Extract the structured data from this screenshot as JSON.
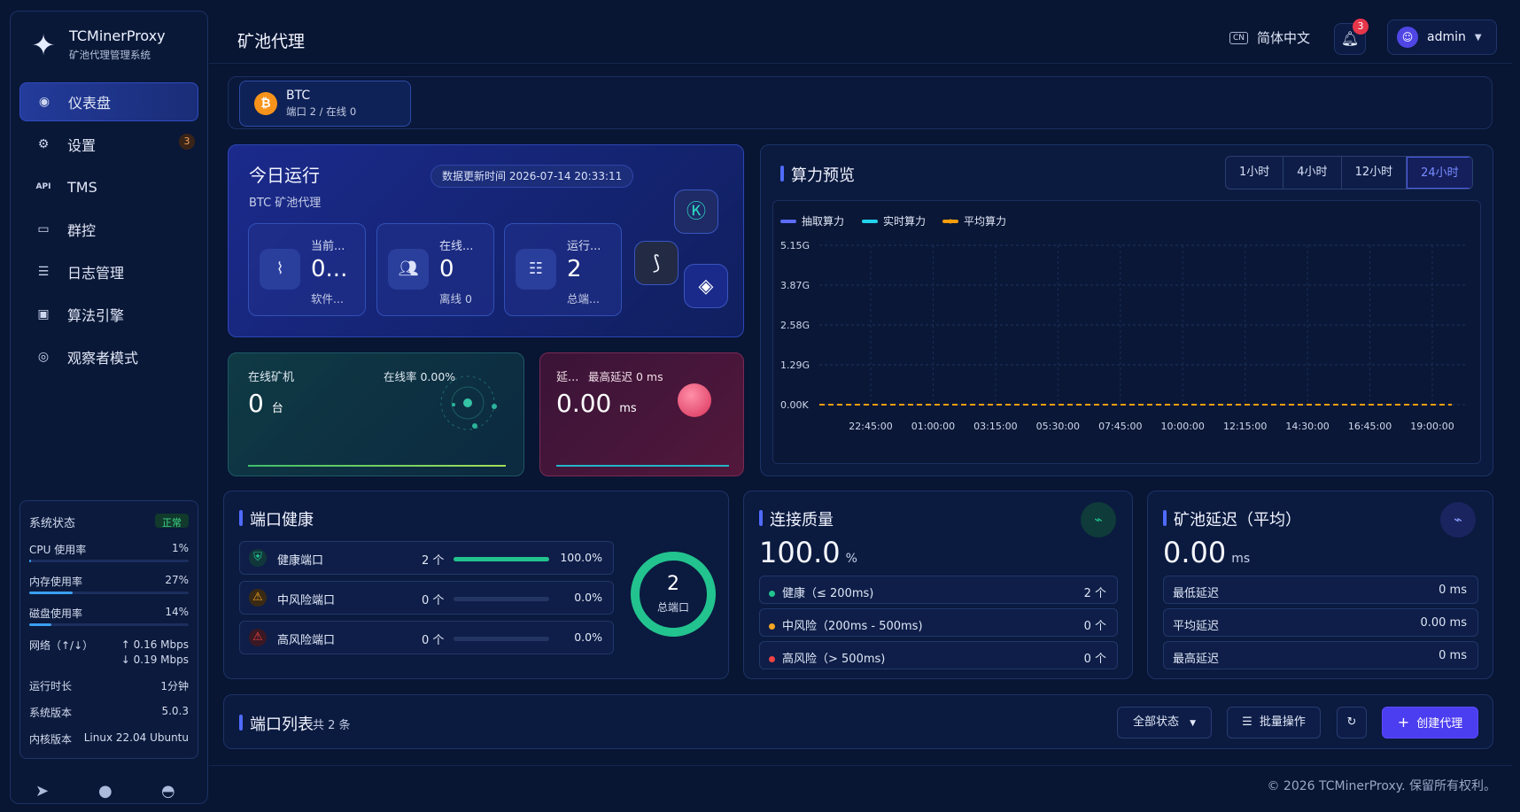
{
  "brand": {
    "name": "TCMinerProxy",
    "subtitle": "矿池代理管理系统"
  },
  "sidebar": {
    "items": [
      {
        "label": "仪表盘",
        "icon": "dashboard-icon",
        "active": true
      },
      {
        "label": "设置",
        "icon": "gear-icon",
        "badge": "3"
      },
      {
        "label": "TMS",
        "icon": "api-icon"
      },
      {
        "label": "群控",
        "icon": "monitor-icon"
      },
      {
        "label": "日志管理",
        "icon": "log-list-icon"
      },
      {
        "label": "算法引擎",
        "icon": "chip-icon"
      },
      {
        "label": "观察者模式",
        "icon": "eye-icon"
      }
    ],
    "api_icon_text": "API",
    "system": {
      "title": "系统状态",
      "status": "正常",
      "cpu_label": "CPU 使用率",
      "cpu": "1%",
      "cpu_fraction": 0.01,
      "mem_label": "内存使用率",
      "mem": "27%",
      "mem_fraction": 0.27,
      "disk_label": "磁盘使用率",
      "disk": "14%",
      "disk_fraction": 0.14,
      "net_label": "网络（↑/↓）",
      "net_up": "↑  0.16 Mbps",
      "net_down": "↓  0.19 Mbps",
      "uptime_label": "运行时长",
      "uptime": "1分钟",
      "version_label": "系统版本",
      "version": "5.0.3",
      "kernel_label": "内核版本",
      "kernel": "Linux 22.04 Ubuntu"
    }
  },
  "header": {
    "title": "矿池代理",
    "lang": "简体中文",
    "lang_icon": "CN",
    "notifications": "3",
    "user": "admin"
  },
  "coin": {
    "name": "BTC",
    "sub": "端口 2 / 在线 0",
    "icon_text": "₿"
  },
  "today": {
    "title": "今日运行",
    "subtitle": "BTC 矿池代理",
    "updated": "数据更新时间 2026-07-14 20:33:11",
    "stats": [
      {
        "label": "当前...",
        "value": "0...",
        "sub": "软件..."
      },
      {
        "label": "在线...",
        "value": "0",
        "sub": "离线 0"
      },
      {
        "label": "运行...",
        "value": "2",
        "sub": "总端..."
      }
    ]
  },
  "miners": {
    "title": "在线矿机",
    "rate": "在线率 0.00%",
    "value": "0",
    "unit": "台"
  },
  "latency": {
    "title": "延...",
    "max": "最高延迟 0 ms",
    "value": "0.00",
    "unit": "ms"
  },
  "hashrate": {
    "title": "算力预览",
    "ranges": [
      "1小时",
      "4小时",
      "12小时",
      "24小时"
    ],
    "active_range": "24小时",
    "colors": {
      "pull": "#5b6cff",
      "realtime": "#22d3ee",
      "average": "#f59e0b"
    },
    "chart_data": {
      "type": "line",
      "x": [
        "22:45:00",
        "01:00:00",
        "03:15:00",
        "05:30:00",
        "07:45:00",
        "10:00:00",
        "12:15:00",
        "14:30:00",
        "16:45:00",
        "19:00:00"
      ],
      "y_ticks": [
        "5.15G",
        "3.87G",
        "2.58G",
        "1.29G",
        "0.00K"
      ],
      "ylim": [
        0,
        5.15
      ],
      "series": [
        {
          "name": "抽取算力",
          "values": []
        },
        {
          "name": "实时算力",
          "values": []
        },
        {
          "name": "平均算力",
          "values": [
            0,
            0,
            0,
            0,
            0,
            0,
            0,
            0,
            0,
            0
          ]
        }
      ],
      "legend": "top-left",
      "grid": true
    }
  },
  "port_health": {
    "title": "端口健康",
    "rows": [
      {
        "label": "健康端口",
        "count": "2 个",
        "percent": "100.0%",
        "fraction": 1.0,
        "color": "#22c38e",
        "icon": "shield-check-icon"
      },
      {
        "label": "中风险端口",
        "count": "0 个",
        "percent": "0.0%",
        "fraction": 0,
        "color": "#f5a524",
        "icon": "warning-icon"
      },
      {
        "label": "高风险端口",
        "count": "0 个",
        "percent": "0.0%",
        "fraction": 0,
        "color": "#ef4444",
        "icon": "alert-icon"
      }
    ],
    "total": "2",
    "total_label": "总端口"
  },
  "quality": {
    "title": "连接质量",
    "value": "100.0",
    "unit": "%",
    "rows": [
      {
        "label": "健康（≤ 200ms)",
        "value": "2 个",
        "color": "#22c38e"
      },
      {
        "label": "中风险（200ms - 500ms)",
        "value": "0 个",
        "color": "#f5a524"
      },
      {
        "label": "高风险（> 500ms)",
        "value": "0 个",
        "color": "#ef4444"
      }
    ]
  },
  "pool_latency": {
    "title": "矿池延迟（平均）",
    "value": "0.00",
    "unit": "ms",
    "rows": [
      {
        "label": "最低延迟",
        "value": "0 ms"
      },
      {
        "label": "平均延迟",
        "value": "0.00 ms"
      },
      {
        "label": "最高延迟",
        "value": "0 ms"
      }
    ]
  },
  "port_list": {
    "title": "端口列表",
    "count": "共 2 条",
    "filter": "全部状态",
    "batch": "批量操作",
    "create": "创建代理"
  },
  "footer": {
    "copyright": "© 2026 TCMinerProxy. 保留所有权利。"
  }
}
